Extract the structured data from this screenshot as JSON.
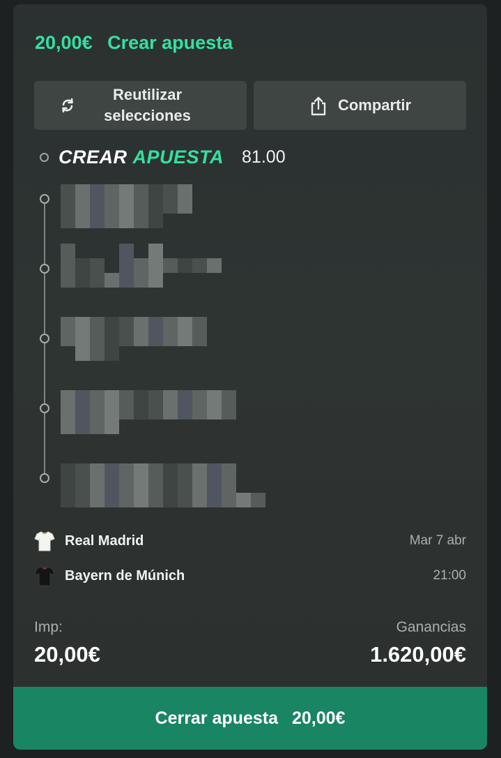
{
  "header": {
    "amount": "20,00€",
    "title": "Crear apuesta"
  },
  "actions": {
    "reuse_label": "Reutilizar selecciones",
    "share_label": "Compartir"
  },
  "bet_builder": {
    "logo_part1": "CREAR",
    "logo_part2": "APUESTA",
    "odds": "81.00",
    "selections_count": 5
  },
  "match": {
    "home_team": "Real Madrid",
    "away_team": "Bayern de Múnich",
    "date": "Mar 7 abr",
    "time": "21:00"
  },
  "stake": {
    "label": "Imp:",
    "value": "20,00€"
  },
  "winnings": {
    "label": "Ganancias",
    "value": "1.620,00€"
  },
  "cashout": {
    "label": "Cerrar apuesta",
    "amount": "20,00€"
  },
  "colors": {
    "accent": "#34e0a1",
    "cashout_bg": "#198562",
    "card_bg": "#2e3432",
    "button_bg": "#3e4543"
  },
  "icons": [
    "refresh-icon",
    "share-icon",
    "white-shirt-icon",
    "black-shirt-icon"
  ]
}
